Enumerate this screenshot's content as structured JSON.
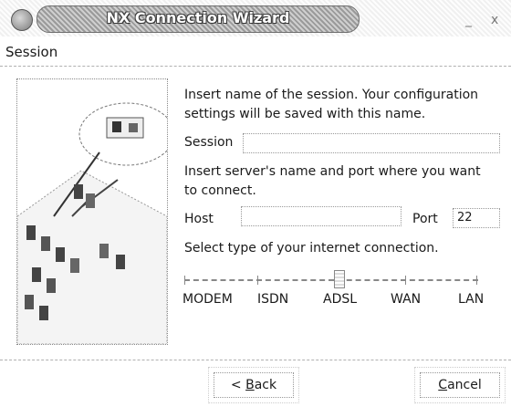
{
  "window": {
    "title": "NX Connection Wizard",
    "minimize_glyph": "_",
    "close_glyph": "x"
  },
  "section": {
    "title": "Session"
  },
  "instructions": {
    "session": "Insert name of the session. Your configuration settings will be saved with this name.",
    "host": "Insert server's name and port where you want to connect.",
    "connection": "Select type of your internet connection."
  },
  "session_field": {
    "label": "Session",
    "value": ""
  },
  "host_field": {
    "label": "Host",
    "value": ""
  },
  "port_field": {
    "label": "Port",
    "value": "22"
  },
  "connection_slider": {
    "options": [
      "MODEM",
      "ISDN",
      "ADSL",
      "WAN",
      "LAN"
    ],
    "selected": "ADSL"
  },
  "buttons": {
    "back": {
      "prefix": "< ",
      "hotkey": "B",
      "rest": "ack"
    },
    "cancel": {
      "hotkey": "C",
      "rest": "ancel"
    }
  },
  "icons": {
    "window_menu": "window-menu-icon",
    "illustration": "network-illustration"
  }
}
